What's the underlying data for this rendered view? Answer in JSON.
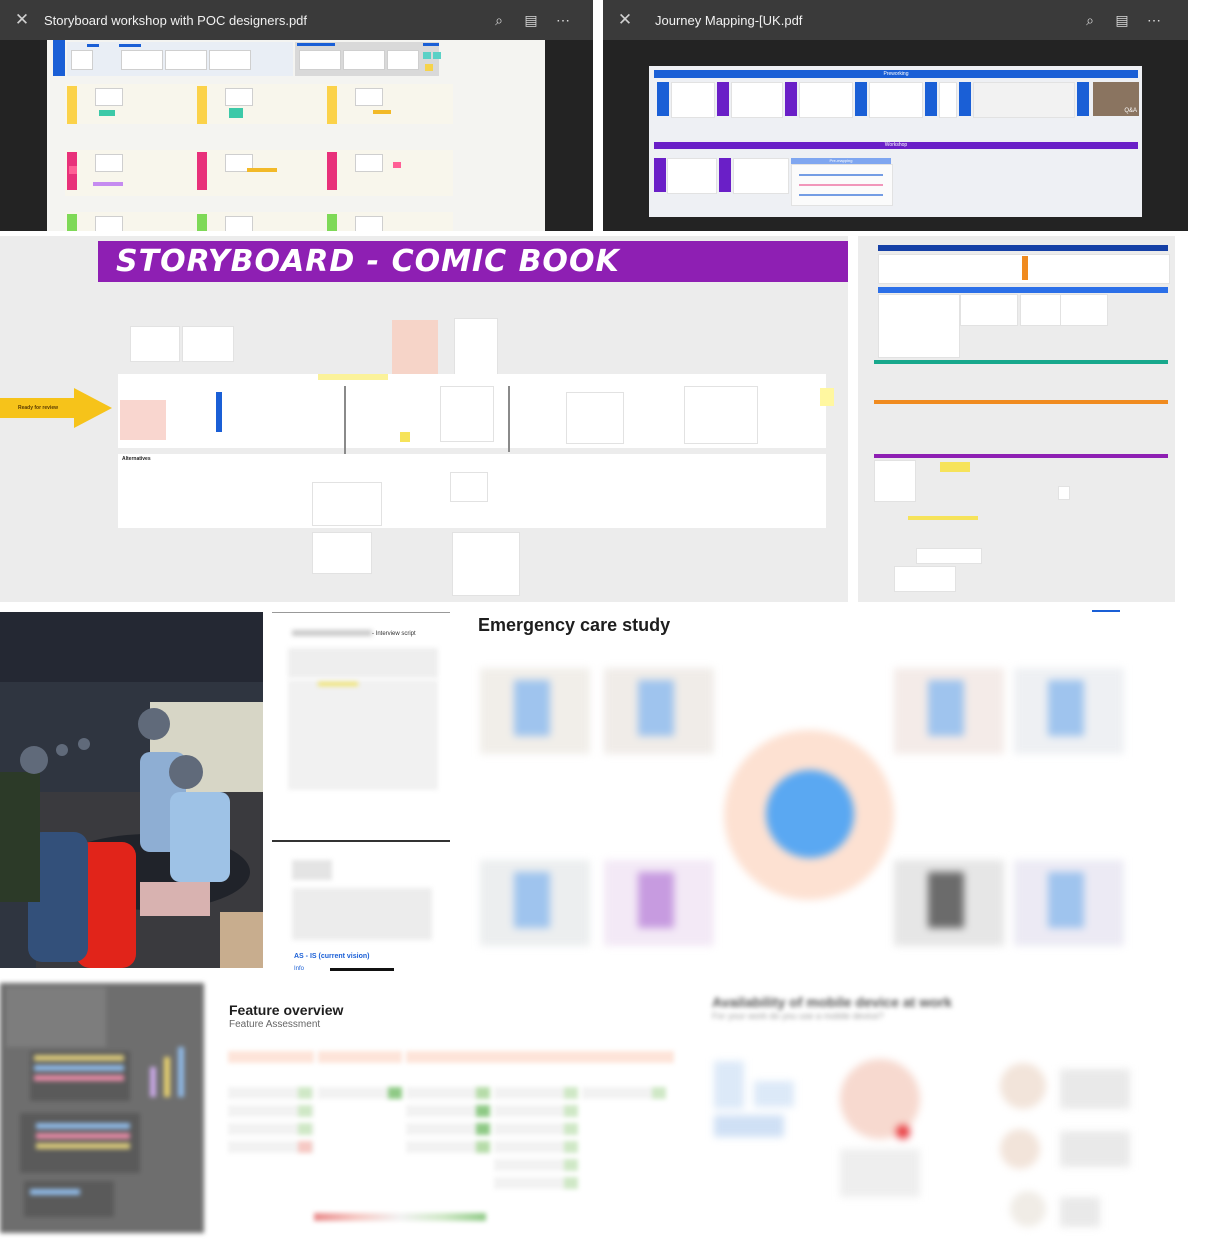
{
  "viewer_left": {
    "title": "Storyboard workshop with POC designers.pdf",
    "close_icon": "close-icon",
    "actions": [
      "find-in-page-icon",
      "comment-icon",
      "more-icon"
    ]
  },
  "viewer_right": {
    "title": "Journey Mapping-[UK.pdf",
    "close_icon": "close-icon",
    "actions": [
      "find-in-page-icon",
      "comment-icon",
      "more-icon"
    ],
    "sections": [
      "Preworking",
      "Workshop",
      "Pre-mapping",
      "Q&A"
    ]
  },
  "storyboard": {
    "banner": "STORYBOARD - COMIC BOOK",
    "arrow_label": "Ready for review",
    "alternatives_label": "Alternatives"
  },
  "interview": {
    "script_label": "- Interview script",
    "as_is_label": "AS - IS (current vision)",
    "info_label": "Info"
  },
  "emergency": {
    "title": "Emergency care study"
  },
  "feature": {
    "title": "Feature overview",
    "subtitle": "Feature Assessment"
  },
  "mobile": {
    "title": "Availability of mobile device at work",
    "subtitle": "For your work do you use a mobile device?"
  },
  "colors": {
    "viewer_bg": "#232323",
    "viewer_bar": "#3a3a3a",
    "storyboard_purple": "#8e1fb3",
    "arrow_yellow": "#f6c31a",
    "blue_accent": "#1a5fd6",
    "pink": "#e8317a",
    "yellow": "#fbd24a"
  }
}
